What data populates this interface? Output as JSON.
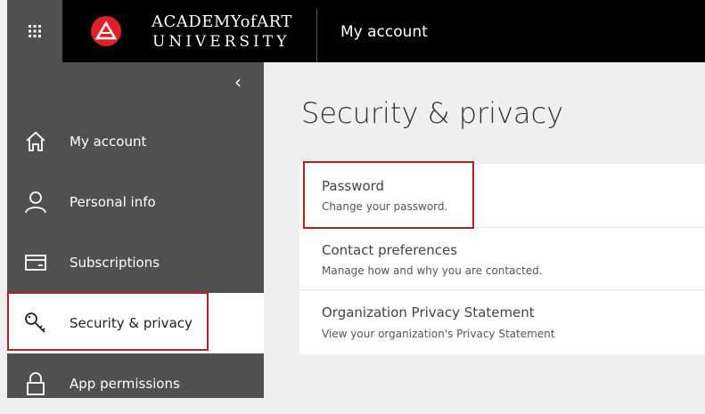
{
  "header": {
    "waffle": "app-launcher",
    "logo_line1": "ACADEMYofART",
    "logo_line2": "UNIVERSITY",
    "app_title": "My account"
  },
  "sidebar": {
    "collapse_glyph": "‹",
    "items": [
      {
        "label": "My account",
        "icon": "home-icon"
      },
      {
        "label": "Personal info",
        "icon": "person-icon"
      },
      {
        "label": "Subscriptions",
        "icon": "card-icon"
      },
      {
        "label": "Security & privacy",
        "icon": "key-icon"
      },
      {
        "label": "App permissions",
        "icon": "lock-icon"
      }
    ]
  },
  "main": {
    "title": "Security & privacy",
    "sections": [
      {
        "title": "Password",
        "desc": "Change your password."
      },
      {
        "title": "Contact preferences",
        "desc": "Manage how and why you are contacted."
      },
      {
        "title": "Organization Privacy Statement",
        "desc": "View your organization's Privacy Statement"
      }
    ]
  },
  "colors": {
    "topbar": "#000000",
    "sidebar": "#505050",
    "accent_red": "#e21f26",
    "highlight": "#b72025"
  }
}
